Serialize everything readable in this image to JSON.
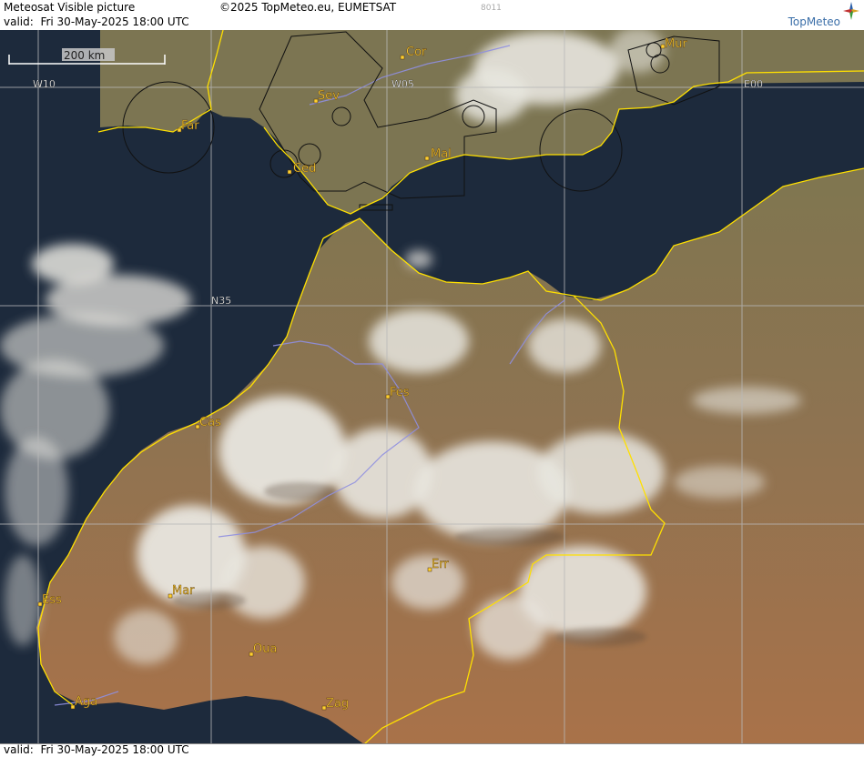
{
  "header": {
    "title": "Meteosat Visible picture",
    "valid_prefix": "valid:",
    "valid_time": "Fri  30-May-2025  18:00 UTC",
    "copyright": "©2025 TopMeteo.eu, EUMETSAT",
    "image_code": "8011",
    "logo_text": "TopMeteo"
  },
  "footer": {
    "valid_prefix": "valid:",
    "valid_time": "Fri  30-May-2025  18:00 UTC"
  },
  "scale_bar": {
    "label": "200 km"
  },
  "grid_labels": {
    "w10": "W10",
    "w05": "W05",
    "e00": "E00",
    "n35": "N35"
  },
  "cities": [
    {
      "key": "cor",
      "label": "Cor"
    },
    {
      "key": "mur",
      "label": "Mur"
    },
    {
      "key": "sev",
      "label": "Sev"
    },
    {
      "key": "far",
      "label": "Far"
    },
    {
      "key": "ced",
      "label": "Ced"
    },
    {
      "key": "mal",
      "label": "Mal"
    },
    {
      "key": "fes",
      "label": "Fes"
    },
    {
      "key": "cas",
      "label": "Cas"
    },
    {
      "key": "err",
      "label": "Err"
    },
    {
      "key": "mar",
      "label": "Mar"
    },
    {
      "key": "ess",
      "label": "Ess"
    },
    {
      "key": "oua",
      "label": "Oua"
    },
    {
      "key": "aga",
      "label": "Aga"
    },
    {
      "key": "zag",
      "label": "Zag"
    }
  ],
  "colors": {
    "ocean": "#1d2a3c",
    "land": "#a06e4a",
    "land_north": "#8a7a55",
    "cloud": "#e8e6df",
    "coastline": "#ffe000",
    "river": "#8f8fe0",
    "grid": "#b8b8b8",
    "city_label": "#ffd030"
  }
}
